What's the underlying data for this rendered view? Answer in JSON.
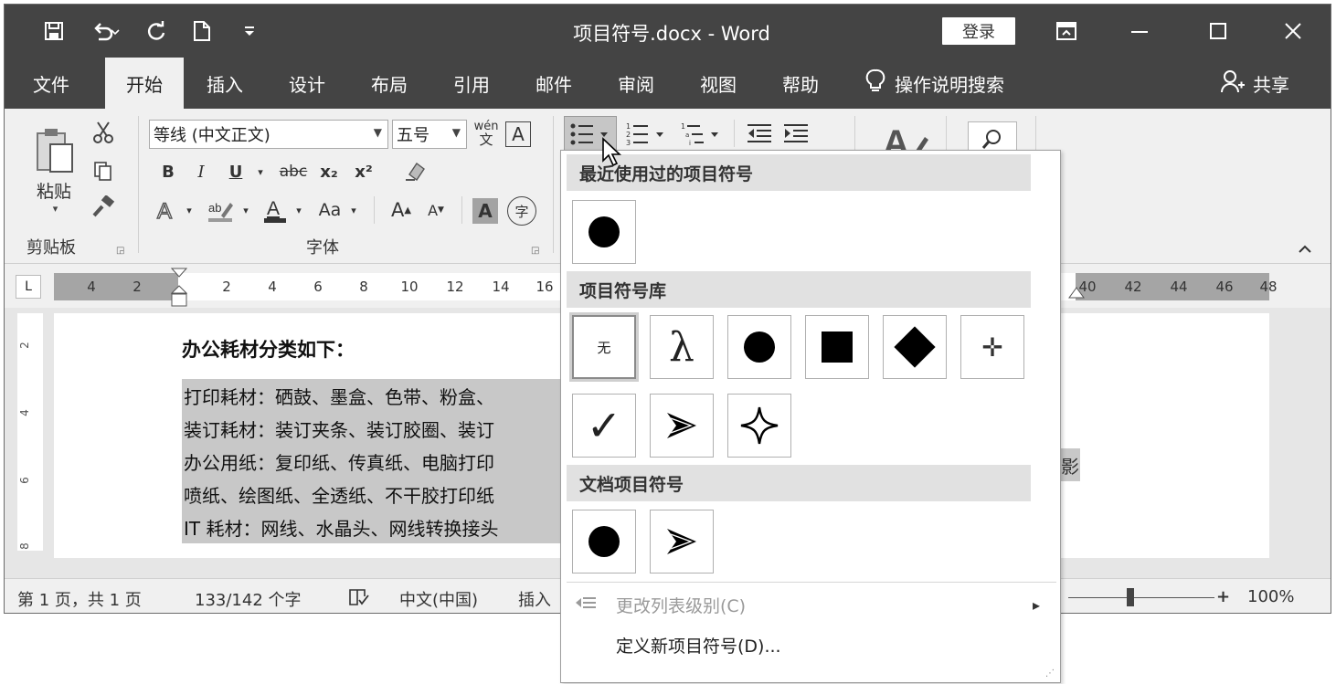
{
  "window": {
    "title": "项目符号.docx  -  Word",
    "login": "登录"
  },
  "tabs": [
    "文件",
    "开始",
    "插入",
    "设计",
    "布局",
    "引用",
    "邮件",
    "审阅",
    "视图",
    "帮助"
  ],
  "active_tab": "开始",
  "tellme": "操作说明搜索",
  "share": "共享",
  "ribbon": {
    "clipboard": {
      "paste_label": "粘贴",
      "group_label": "剪贴板"
    },
    "font": {
      "font_name": "等线 (中文正文)",
      "font_size": "五号",
      "group_label": "字体",
      "phonetic": "wén",
      "phonetic_char": "文",
      "border_char": "A",
      "bold": "B",
      "italic": "I",
      "underline": "U",
      "strike": "abc",
      "sub": "x₂",
      "sup": "x²",
      "case": "Aa",
      "grow": "A",
      "shrink": "A",
      "shade_char": "A",
      "enclose_char": "字"
    }
  },
  "ruler": {
    "left_numbers": [
      "4",
      "2"
    ],
    "numbers": [
      "2",
      "4",
      "6",
      "8",
      "10",
      "12",
      "14",
      "16"
    ],
    "right_numbers": [
      "40",
      "42",
      "44",
      "46",
      "48"
    ],
    "corner": "L"
  },
  "vruler": [
    "2",
    "4",
    "6",
    "8"
  ],
  "document": {
    "heading": "办公耗材分类如下：",
    "lines": [
      "打印耗材：硒鼓、墨盒、色带、粉盒、",
      "装订耗材：装订夹条、装订胶圈、装订",
      "办公用纸：复印纸、传真纸、电脑打印",
      "喷纸、绘图纸、全透纸、不干胶打印纸",
      "IT 耗材：网线、水晶头、网线转换接头"
    ],
    "trailing_glyph": "影"
  },
  "statusbar": {
    "page": "第 1 页，共 1 页",
    "words": "133/142 个字",
    "language": "中文(中国)",
    "mode": "插入",
    "zoom": "100%",
    "zoom_minus": "-",
    "zoom_plus": "+"
  },
  "bullet_menu": {
    "recent_header": "最近使用过的项目符号",
    "library_header": "项目符号库",
    "document_header": "文档项目符号",
    "none_label": "无",
    "lambda": "λ",
    "check": "✓",
    "plus_glyph": "✛",
    "change_level": "更改列表级别(C)",
    "define_new": "定义新项目符号(D)...",
    "submenu_arrow": "▸"
  }
}
